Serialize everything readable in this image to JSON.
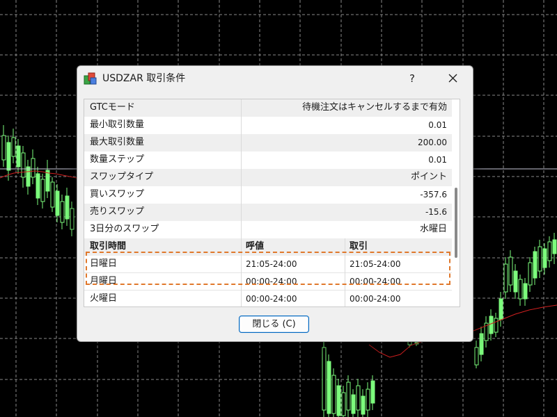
{
  "dialog": {
    "title": "USDZAR 取引条件",
    "help_label": "?",
    "close_button_label": "閉じる (C)"
  },
  "properties": [
    {
      "key": "GTCモード",
      "value": "待機注文はキャンセルするまで有効"
    },
    {
      "key": "最小取引数量",
      "value": "0.01"
    },
    {
      "key": "最大取引数量",
      "value": "200.00"
    },
    {
      "key": "数量ステップ",
      "value": "0.01"
    },
    {
      "key": "スワップタイプ",
      "value": "ポイント"
    },
    {
      "key": "買いスワップ",
      "value": "-357.6"
    },
    {
      "key": "売りスワップ",
      "value": "-15.6"
    },
    {
      "key": "3日分のスワップ",
      "value": "水曜日"
    }
  ],
  "schedule": {
    "headers": [
      "取引時間",
      "呼値",
      "取引"
    ],
    "rows": [
      [
        "日曜日",
        "21:05-24:00",
        "21:05-24:00"
      ],
      [
        "月曜日",
        "00:00-24:00",
        "00:00-24:00"
      ],
      [
        "火曜日",
        "00:00-24:00",
        "00:00-24:00"
      ]
    ]
  },
  "colors": {
    "highlight": "#e0782b",
    "chart_background": "#000000",
    "candle": "#7CFC7C",
    "moving_average": "#d22020"
  }
}
